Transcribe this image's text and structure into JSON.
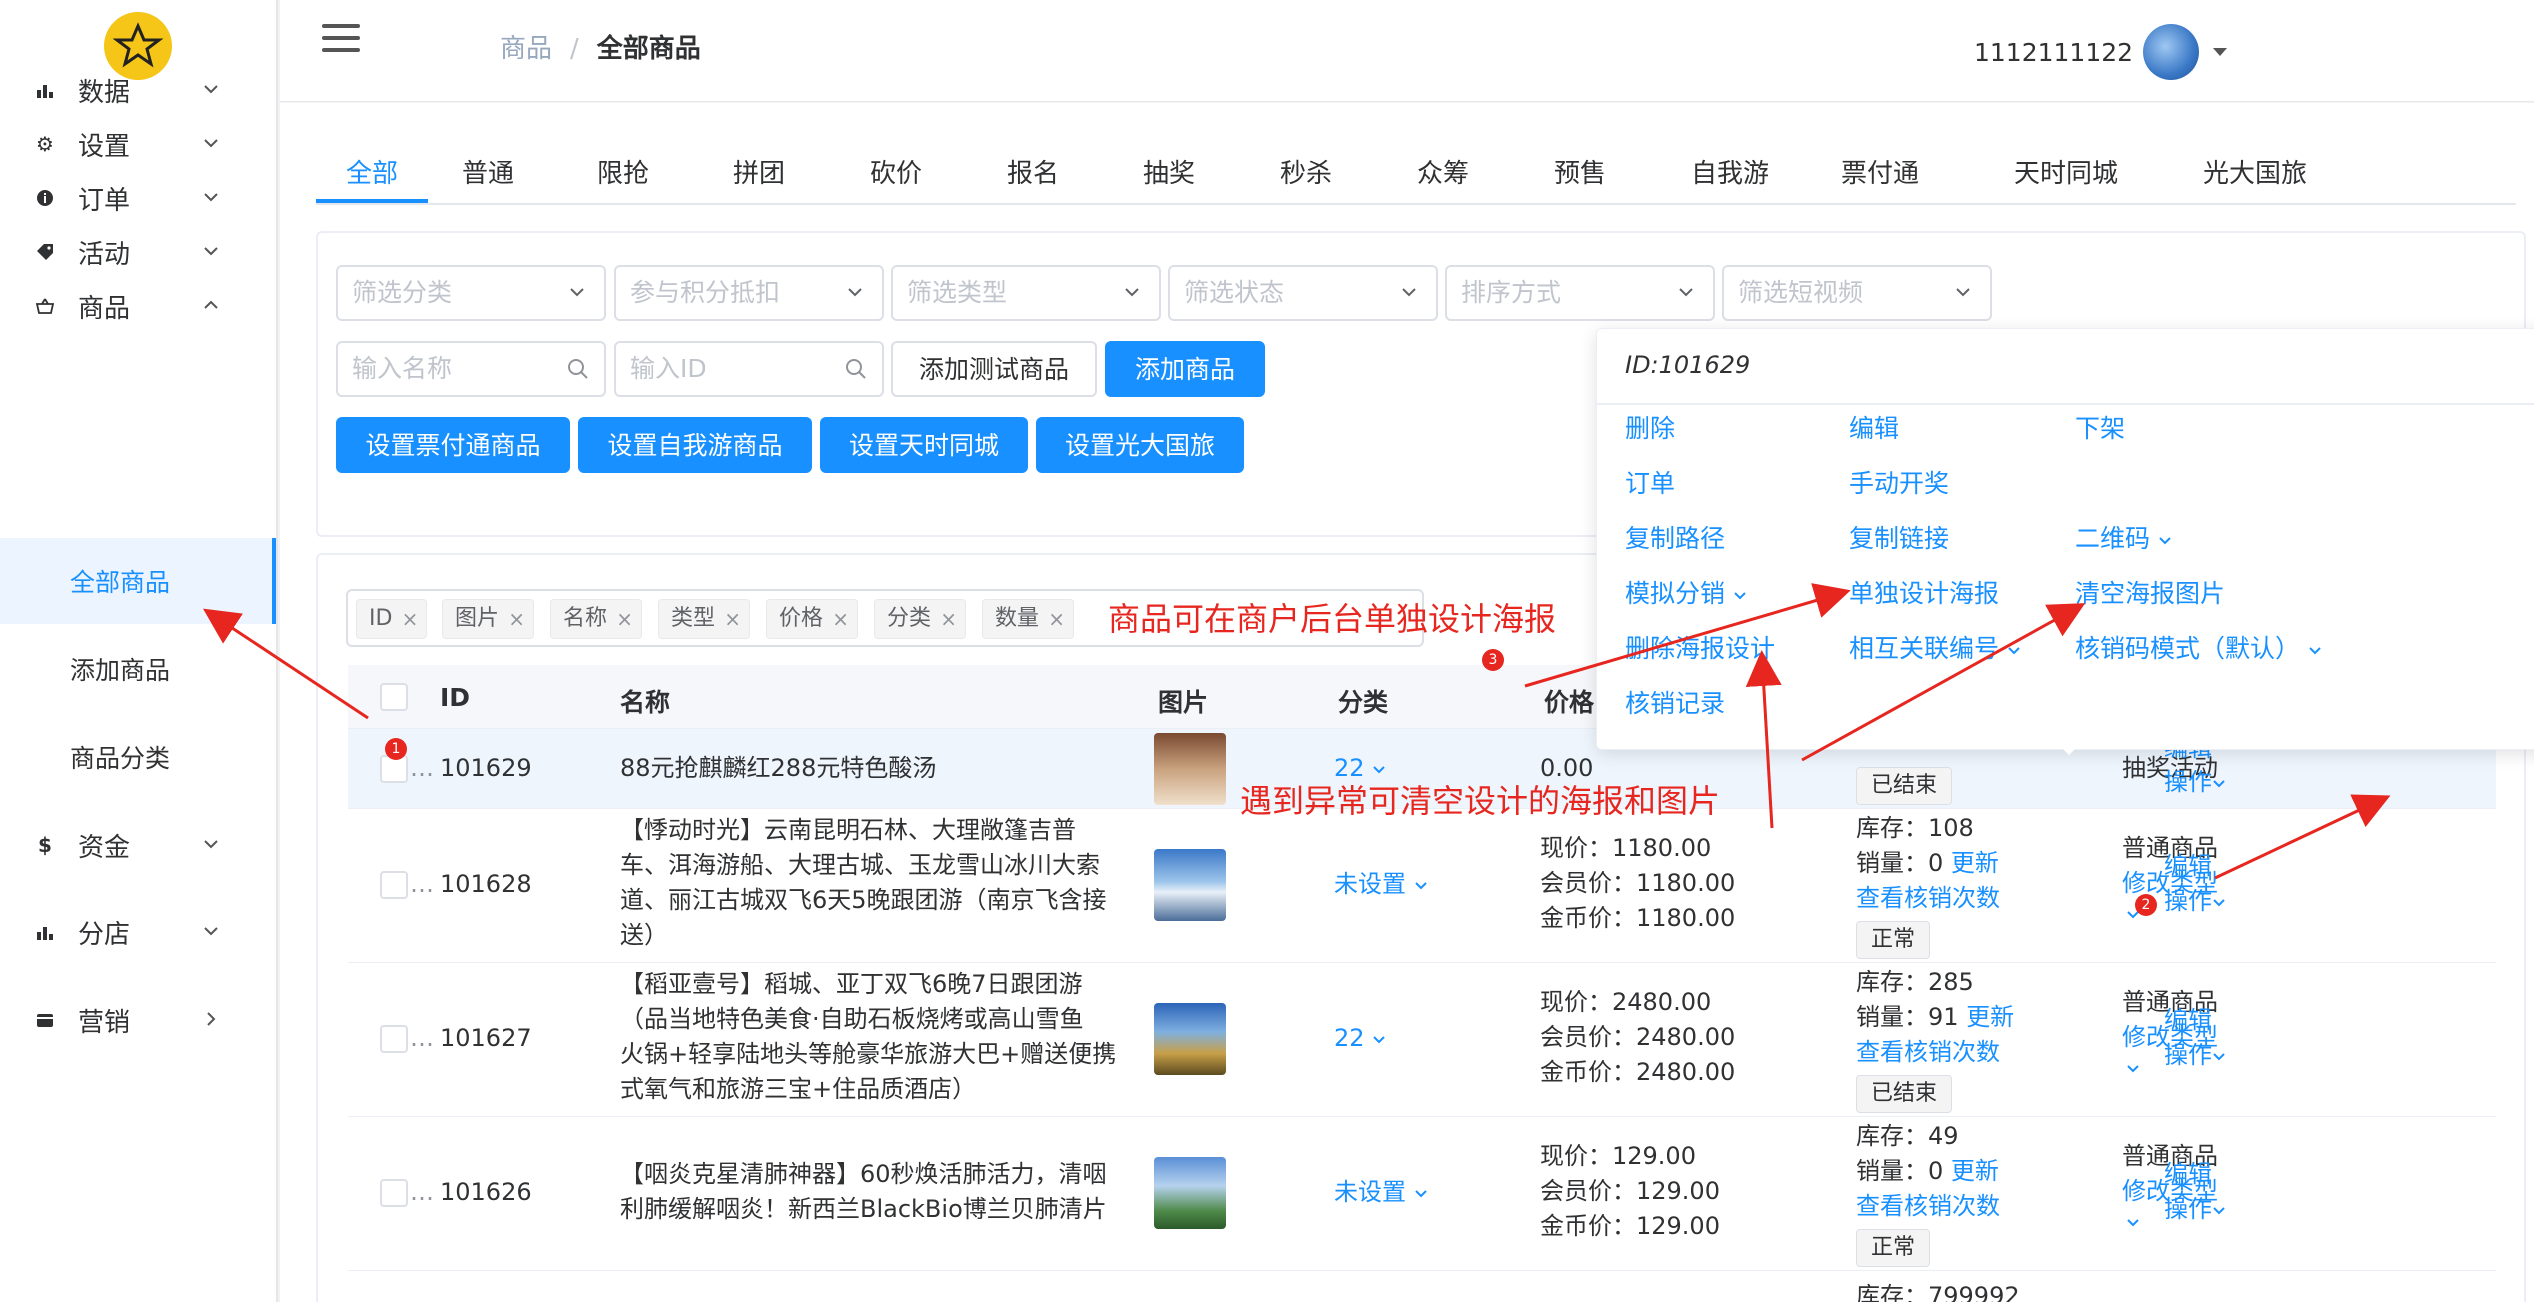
{
  "sidebar": {
    "menu": [
      {
        "label": "数据",
        "icon": "bar-chart-icon"
      },
      {
        "label": "设置",
        "icon": "gear-icon"
      },
      {
        "label": "订单",
        "icon": "info-icon"
      },
      {
        "label": "活动",
        "icon": "tag-icon"
      },
      {
        "label": "商品",
        "icon": "basket-icon"
      },
      {
        "label": "资金",
        "icon": "dollar-icon"
      },
      {
        "label": "分店",
        "icon": "bar-chart-icon"
      },
      {
        "label": "营销",
        "icon": "wallet-icon"
      }
    ],
    "submenu": [
      "全部商品",
      "添加商品",
      "商品分类"
    ]
  },
  "header": {
    "breadcrumb_parent": "商品",
    "breadcrumb_sep": "/",
    "breadcrumb_current": "全部商品",
    "username": "1112111122"
  },
  "tabs": [
    "全部",
    "普通",
    "限抢",
    "拼团",
    "砍价",
    "报名",
    "抽奖",
    "秒杀",
    "众筹",
    "预售",
    "自我游",
    "票付通",
    "天时同城",
    "光大国旅"
  ],
  "filters": {
    "selects": [
      "筛选分类",
      "参与积分抵扣",
      "筛选类型",
      "筛选状态",
      "排序方式",
      "筛选短视频"
    ],
    "name_placeholder": "输入名称",
    "id_placeholder": "输入ID",
    "btn_add_test": "添加测试商品",
    "btn_add": "添加商品",
    "btn_row2": [
      "设置票付通商品",
      "设置自我游商品",
      "设置天时同城",
      "设置光大国旅"
    ]
  },
  "column_tags": [
    "ID",
    "图片",
    "名称",
    "类型",
    "价格",
    "分类",
    "数量"
  ],
  "table": {
    "headers": {
      "id": "ID",
      "name": "名称",
      "image": "图片",
      "category": "分类",
      "price": "价格"
    },
    "rows": [
      {
        "id": "101629",
        "name": [
          "88元抢麒麟红288元特色酸汤"
        ],
        "category": "22",
        "price": [
          "0.00"
        ],
        "stock": [],
        "status": "已结束",
        "type": [
          "抽奖活动"
        ],
        "ops": [
          "编辑",
          "操作"
        ]
      },
      {
        "id": "101628",
        "name": [
          "【悸动时光】云南昆明石林、大理敞篷吉普",
          "车、洱海游船、大理古城、玉龙雪山冰川大索",
          "道、丽江古城双飞6天5晚跟团游（南京飞含接",
          "送）"
        ],
        "category": "未设置",
        "price": [
          "现价：1180.00",
          "会员价：1180.00",
          "金币价：1180.00"
        ],
        "stock": [
          "库存：108",
          "销量：0",
          "查看核销次数"
        ],
        "update": "更新",
        "status": "正常",
        "type": [
          "普通商品",
          "修改类型"
        ],
        "ops": [
          "编辑",
          "操作"
        ]
      },
      {
        "id": "101627",
        "name": [
          "【稻亚壹号】稻城、亚丁双飞6晚7日跟团游",
          "（品当地特色美食·自助石板烧烤或高山雪鱼",
          "火锅+轻享陆地头等舱豪华旅游大巴+赠送便携",
          "式氧气和旅游三宝+住品质酒店）"
        ],
        "category": "22",
        "price": [
          "现价：2480.00",
          "会员价：2480.00",
          "金币价：2480.00"
        ],
        "stock": [
          "库存：285",
          "销量：91",
          "查看核销次数"
        ],
        "update": "更新",
        "status": "已结束",
        "type": [
          "普通商品",
          "修改类型"
        ],
        "ops": [
          "编辑",
          "操作"
        ]
      },
      {
        "id": "101626",
        "name": [
          "【咽炎克星清肺神器】60秒焕活肺活力，清咽",
          "利肺缓解咽炎！新西兰BlackBio博兰贝肺清片"
        ],
        "category": "未设置",
        "price": [
          "现价：129.00",
          "会员价：129.00",
          "金币价：129.00"
        ],
        "stock": [
          "库存：49",
          "销量：0",
          "查看核销次数"
        ],
        "update": "更新",
        "status": "正常",
        "type": [
          "普通商品",
          "修改类型"
        ],
        "ops": [
          "编辑",
          "操作"
        ]
      }
    ],
    "partial_row_stock": "库存：799992"
  },
  "popover": {
    "id_label": "ID:101629",
    "items": [
      "删除",
      "编辑",
      "下架",
      "订单",
      "手动开奖",
      "复制路径",
      "复制链接",
      "二维码",
      "模拟分销",
      "单独设计海报",
      "清空海报图片",
      "删除海报设计",
      "相互关联编号",
      "核销码模式（默认）",
      "核销记录"
    ]
  },
  "annotations": {
    "text1": "商品可在商户后台单独设计海报",
    "text2": "遇到异常可清空设计的海报和图片",
    "badges": [
      "1",
      "2",
      "3"
    ]
  },
  "colors": {
    "accent": "#1890ff",
    "annotation_red": "#e6261f",
    "row_highlight": "#eef5fd"
  }
}
